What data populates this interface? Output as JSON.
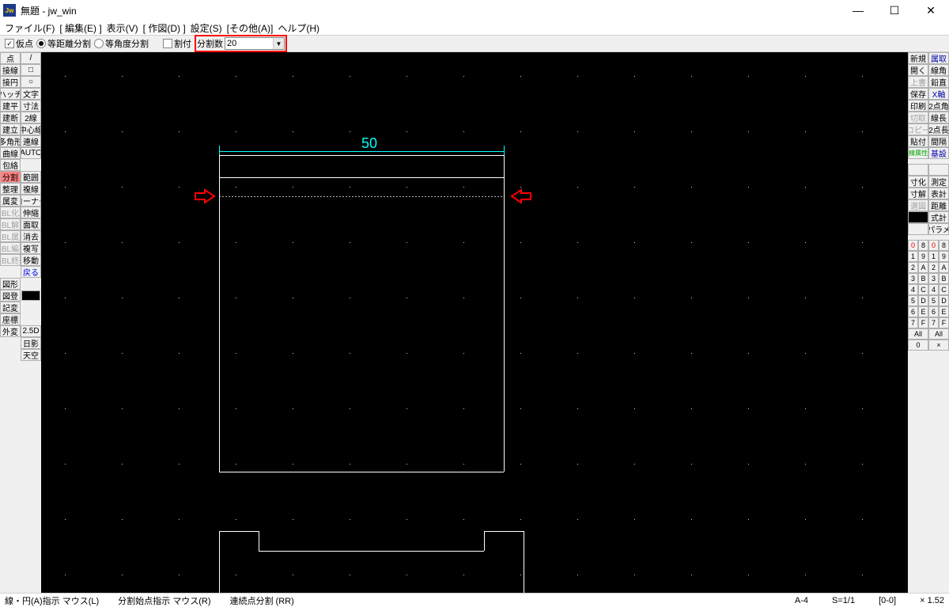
{
  "title": "無題 - jw_win",
  "menu": [
    "ファイル(F)",
    "[ 編集(E) ]",
    "表示(V)",
    "[ 作図(D) ]",
    "設定(S)",
    "[その他(A)]",
    "ヘルプ(H)"
  ],
  "options": {
    "karipoint": "仮点",
    "eqdist": "等距離分割",
    "eqang": "等角度分割",
    "waritsuke": "割付",
    "split_label": "分割数",
    "split_value": "20"
  },
  "left_col1": [
    "点",
    "接線",
    "接円",
    "ハッチ",
    "建平",
    "建断",
    "建立",
    "多角形",
    "曲線",
    "包絡",
    "分割",
    "整理",
    "属変",
    "BL化",
    "BL解",
    "BL属",
    "BL編",
    "BL終",
    "",
    "図形",
    "図登",
    "記変",
    "座標",
    "外変"
  ],
  "left_col2_icons": [
    "line",
    "rect",
    "circle"
  ],
  "left_col2": [
    "文字",
    "寸法",
    "2線",
    "中心線",
    "連線",
    "AUTO",
    "",
    "範囲",
    "複線",
    "コーナー",
    "伸縮",
    "面取",
    "消去",
    "複写",
    "移動",
    "戻る",
    "",
    "",
    "",
    "2.5D",
    "日影",
    "天空"
  ],
  "right_rows": [
    [
      "新規",
      "属取"
    ],
    [
      "開く",
      "線角"
    ],
    [
      "上書",
      "鉛直"
    ],
    [
      "保存",
      "X軸"
    ],
    [
      "印刷",
      "2点角"
    ],
    [
      "切取",
      "線長"
    ],
    [
      "コピー",
      "2点長"
    ],
    [
      "貼付",
      "間隔"
    ],
    [
      "線属性",
      "基設"
    ],
    [
      "",
      ""
    ],
    [
      "寸化",
      "測定"
    ],
    [
      "寸解",
      "表計"
    ],
    [
      "選図",
      "距離"
    ],
    [
      "",
      "式計"
    ],
    [
      "",
      "パラメ"
    ]
  ],
  "layers": [
    [
      "0",
      "8",
      "0",
      "8"
    ],
    [
      "1",
      "9",
      "1",
      "9"
    ],
    [
      "2",
      "A",
      "2",
      "A"
    ],
    [
      "3",
      "B",
      "3",
      "B"
    ],
    [
      "4",
      "C",
      "4",
      "C"
    ],
    [
      "5",
      "D",
      "5",
      "D"
    ],
    [
      "6",
      "E",
      "6",
      "E"
    ],
    [
      "7",
      "F",
      "7",
      "F"
    ]
  ],
  "all_labels": [
    "All",
    "All"
  ],
  "all_values": [
    "0",
    "×"
  ],
  "dimension": "50",
  "status": {
    "left1": "線・円(A)指示  マウス(L)",
    "left2": "分割始点指示  マウス(R)",
    "left3": "連続点分割 (RR)",
    "r1": "A-4",
    "r2": "S=1/1",
    "r3": "[0-0]",
    "r4": "× 1.52"
  }
}
